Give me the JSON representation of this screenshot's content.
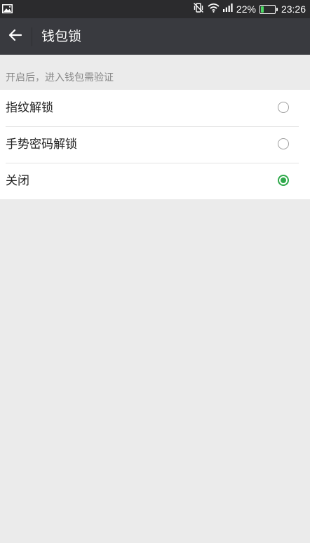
{
  "status_bar": {
    "battery_text": "22%",
    "battery_level": 0.22,
    "battery_color": "#4cd964",
    "time": "23:26",
    "icons": [
      "image-icon",
      "vibrate-icon",
      "wifi-icon",
      "signal-icon",
      "battery-icon"
    ]
  },
  "header": {
    "back_icon": "arrow-left-icon",
    "title": "钱包锁"
  },
  "section": {
    "hint": "开启后，进入钱包需验证"
  },
  "options": [
    {
      "label": "指纹解锁",
      "selected": false
    },
    {
      "label": "手势密码解锁",
      "selected": false
    },
    {
      "label": "关闭",
      "selected": true
    }
  ],
  "colors": {
    "header_bg": "#393a3f",
    "accent": "#2fa94b",
    "page_bg": "#ebebeb"
  }
}
